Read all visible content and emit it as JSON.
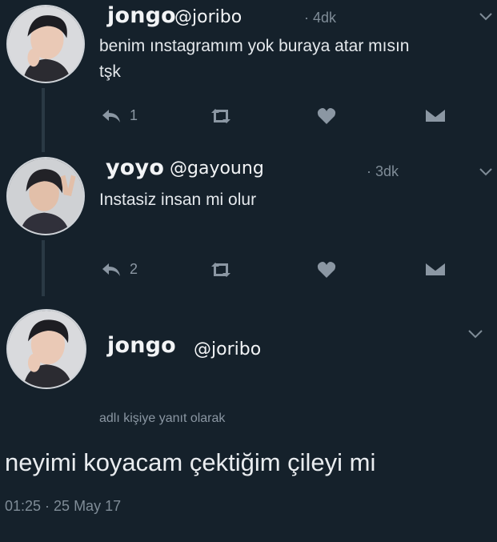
{
  "tweets": [
    {
      "name": "jongo",
      "handle": "@joribo",
      "time": "· 4dk",
      "text_line1": "benim ınstagramım yok buraya atar mısın",
      "text_line2": "tşk",
      "reply_count": "1"
    },
    {
      "name": "yoyo",
      "handle": "@gayoung",
      "time": "· 3dk",
      "text_line1": "Instasiz insan mi olur",
      "reply_count": "2"
    }
  ],
  "main_tweet": {
    "name": "jongo",
    "handle": "@joribo",
    "reply_to": "adlı kişiye yanıt olarak",
    "text": "neyimi koyacam çektiğim çileyi mi",
    "timestamp": "01:25 · 25 May 17"
  },
  "icons": {
    "reply": "reply-icon",
    "retweet": "retweet-icon",
    "like": "heart-icon",
    "dm": "envelope-icon",
    "more": "chevron-down-icon"
  }
}
